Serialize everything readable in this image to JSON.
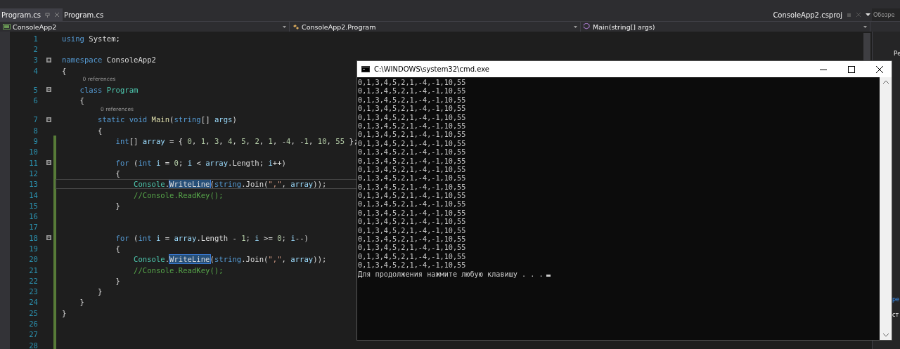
{
  "tabs": [
    {
      "label": "Program.cs",
      "selected": true,
      "pinned": true
    },
    {
      "label": "Program.cs",
      "selected": false,
      "pinned": false
    }
  ],
  "project_tab": {
    "label": "ConsoleApp2.csproj"
  },
  "navigation": {
    "project": "ConsoleApp2",
    "type": "ConsoleApp2.Program",
    "member": "Main(string[] args)"
  },
  "editor": {
    "lines": [
      {
        "number": "1",
        "fold": false,
        "modified": false,
        "segments": [
          {
            "kind": "kw",
            "text": "using"
          },
          {
            "kind": "plain",
            "text": " System;"
          }
        ]
      },
      {
        "number": "2",
        "fold": false,
        "modified": false
      },
      {
        "number": "3",
        "fold": true,
        "modified": false,
        "segments": [
          {
            "kind": "kw",
            "text": "namespace"
          },
          {
            "kind": "plain",
            "text": " ConsoleApp2"
          }
        ]
      },
      {
        "number": "4",
        "fold": false,
        "modified": false,
        "segments": [
          {
            "kind": "plain",
            "text": "{"
          }
        ]
      },
      {
        "number": "5",
        "fold": true,
        "modified": false,
        "lens": "0 references",
        "segments": [
          {
            "kind": "kw",
            "text": "    class "
          },
          {
            "kind": "type",
            "text": "Program"
          }
        ]
      },
      {
        "number": "6",
        "fold": false,
        "modified": false,
        "segments": [
          {
            "kind": "plain",
            "text": "    {"
          }
        ]
      },
      {
        "number": "7",
        "fold": true,
        "modified": false,
        "lens": "0 references",
        "segments": [
          {
            "kind": "kw",
            "text": "        static void "
          },
          {
            "kind": "method",
            "text": "Main"
          },
          {
            "kind": "plain",
            "text": "("
          },
          {
            "kind": "kw",
            "text": "string"
          },
          {
            "kind": "plain",
            "text": "[] "
          },
          {
            "kind": "param",
            "text": "args"
          },
          {
            "kind": "plain",
            "text": ")"
          }
        ]
      },
      {
        "number": "8",
        "fold": false,
        "modified": false,
        "segments": [
          {
            "kind": "plain",
            "text": "        {"
          }
        ]
      },
      {
        "number": "9",
        "fold": false,
        "modified": true,
        "segments": [
          {
            "kind": "kw",
            "text": "            int"
          },
          {
            "kind": "plain",
            "text": "[] "
          },
          {
            "kind": "param",
            "text": "array"
          },
          {
            "kind": "plain",
            "text": " = { "
          },
          {
            "kind": "num",
            "text": "0"
          },
          {
            "kind": "plain",
            "text": ", "
          },
          {
            "kind": "num",
            "text": "1"
          },
          {
            "kind": "plain",
            "text": ", "
          },
          {
            "kind": "num",
            "text": "3"
          },
          {
            "kind": "plain",
            "text": ", "
          },
          {
            "kind": "num",
            "text": "4"
          },
          {
            "kind": "plain",
            "text": ", "
          },
          {
            "kind": "num",
            "text": "5"
          },
          {
            "kind": "plain",
            "text": ", "
          },
          {
            "kind": "num",
            "text": "2"
          },
          {
            "kind": "plain",
            "text": ", "
          },
          {
            "kind": "num",
            "text": "1"
          },
          {
            "kind": "plain",
            "text": ", -"
          },
          {
            "kind": "num",
            "text": "4"
          },
          {
            "kind": "plain",
            "text": ", -"
          },
          {
            "kind": "num",
            "text": "1"
          },
          {
            "kind": "plain",
            "text": ", "
          },
          {
            "kind": "num",
            "text": "10"
          },
          {
            "kind": "plain",
            "text": ", "
          },
          {
            "kind": "num",
            "text": "55"
          },
          {
            "kind": "plain",
            "text": " };"
          }
        ]
      },
      {
        "number": "10",
        "fold": false,
        "modified": true
      },
      {
        "number": "11",
        "fold": true,
        "modified": true,
        "segments": [
          {
            "kind": "kw",
            "text": "            for"
          },
          {
            "kind": "plain",
            "text": " ("
          },
          {
            "kind": "kw",
            "text": "int "
          },
          {
            "kind": "param",
            "text": "i"
          },
          {
            "kind": "plain",
            "text": " = "
          },
          {
            "kind": "num",
            "text": "0"
          },
          {
            "kind": "plain",
            "text": "; "
          },
          {
            "kind": "param",
            "text": "i"
          },
          {
            "kind": "plain",
            "text": " < "
          },
          {
            "kind": "param",
            "text": "array"
          },
          {
            "kind": "plain",
            "text": ".Length; "
          },
          {
            "kind": "param",
            "text": "i"
          },
          {
            "kind": "plain",
            "text": "++)"
          }
        ]
      },
      {
        "number": "12",
        "fold": false,
        "modified": true,
        "segments": [
          {
            "kind": "plain",
            "text": "            {"
          }
        ]
      },
      {
        "number": "13",
        "fold": false,
        "modified": true,
        "current": true,
        "segments": [
          {
            "kind": "type",
            "text": "                Console"
          },
          {
            "kind": "plain",
            "text": "."
          },
          {
            "kind": "highlight",
            "text": "WriteLine"
          },
          {
            "kind": "plain",
            "text": "("
          },
          {
            "kind": "kw",
            "text": "string"
          },
          {
            "kind": "plain",
            "text": ".Join("
          },
          {
            "kind": "str",
            "text": "\",\""
          },
          {
            "kind": "plain",
            "text": ", "
          },
          {
            "kind": "param",
            "text": "array"
          },
          {
            "kind": "plain",
            "text": "));"
          }
        ]
      },
      {
        "number": "14",
        "fold": false,
        "modified": true,
        "segments": [
          {
            "kind": "comment",
            "text": "                //Console.ReadKey();"
          }
        ]
      },
      {
        "number": "15",
        "fold": false,
        "modified": true,
        "segments": [
          {
            "kind": "plain",
            "text": "            }"
          }
        ]
      },
      {
        "number": "16",
        "fold": false,
        "modified": true
      },
      {
        "number": "17",
        "fold": false,
        "modified": true
      },
      {
        "number": "18",
        "fold": true,
        "modified": true,
        "segments": [
          {
            "kind": "kw",
            "text": "            for"
          },
          {
            "kind": "plain",
            "text": " ("
          },
          {
            "kind": "kw",
            "text": "int "
          },
          {
            "kind": "param",
            "text": "i"
          },
          {
            "kind": "plain",
            "text": " = "
          },
          {
            "kind": "param",
            "text": "array"
          },
          {
            "kind": "plain",
            "text": ".Length - "
          },
          {
            "kind": "num",
            "text": "1"
          },
          {
            "kind": "plain",
            "text": "; "
          },
          {
            "kind": "param",
            "text": "i"
          },
          {
            "kind": "plain",
            "text": " >= "
          },
          {
            "kind": "num",
            "text": "0"
          },
          {
            "kind": "plain",
            "text": "; "
          },
          {
            "kind": "param",
            "text": "i"
          },
          {
            "kind": "plain",
            "text": "--)"
          }
        ]
      },
      {
        "number": "19",
        "fold": false,
        "modified": true,
        "segments": [
          {
            "kind": "plain",
            "text": "            {"
          }
        ]
      },
      {
        "number": "20",
        "fold": false,
        "modified": true,
        "segments": [
          {
            "kind": "type",
            "text": "                Console"
          },
          {
            "kind": "plain",
            "text": "."
          },
          {
            "kind": "highlight",
            "text": "WriteLine"
          },
          {
            "kind": "plain",
            "text": "("
          },
          {
            "kind": "kw",
            "text": "string"
          },
          {
            "kind": "plain",
            "text": ".Join("
          },
          {
            "kind": "str",
            "text": "\",\""
          },
          {
            "kind": "plain",
            "text": ", "
          },
          {
            "kind": "param",
            "text": "array"
          },
          {
            "kind": "plain",
            "text": "));"
          }
        ]
      },
      {
        "number": "21",
        "fold": false,
        "modified": true,
        "segments": [
          {
            "kind": "comment",
            "text": "                //Console.ReadKey();"
          }
        ]
      },
      {
        "number": "22",
        "fold": false,
        "modified": true,
        "segments": [
          {
            "kind": "plain",
            "text": "            }"
          }
        ]
      },
      {
        "number": "23",
        "fold": false,
        "modified": true,
        "segments": [
          {
            "kind": "plain",
            "text": "        }"
          }
        ]
      },
      {
        "number": "24",
        "fold": false,
        "modified": true,
        "segments": [
          {
            "kind": "plain",
            "text": "    }"
          }
        ]
      },
      {
        "number": "25",
        "fold": false,
        "modified": true,
        "segments": [
          {
            "kind": "plain",
            "text": "}"
          }
        ]
      },
      {
        "number": "26",
        "fold": false,
        "modified": true
      },
      {
        "number": "27",
        "fold": false,
        "modified": true
      },
      {
        "number": "28",
        "fold": false,
        "modified": true
      }
    ]
  },
  "console": {
    "title": "C:\\WINDOWS\\system32\\cmd.exe",
    "lines": [
      "0,1,3,4,5,2,1,-4,-1,10,55",
      "0,1,3,4,5,2,1,-4,-1,10,55",
      "0,1,3,4,5,2,1,-4,-1,10,55",
      "0,1,3,4,5,2,1,-4,-1,10,55",
      "0,1,3,4,5,2,1,-4,-1,10,55",
      "0,1,3,4,5,2,1,-4,-1,10,55",
      "0,1,3,4,5,2,1,-4,-1,10,55",
      "0,1,3,4,5,2,1,-4,-1,10,55",
      "0,1,3,4,5,2,1,-4,-1,10,55",
      "0,1,3,4,5,2,1,-4,-1,10,55",
      "0,1,3,4,5,2,1,-4,-1,10,55",
      "0,1,3,4,5,2,1,-4,-1,10,55",
      "0,1,3,4,5,2,1,-4,-1,10,55",
      "0,1,3,4,5,2,1,-4,-1,10,55",
      "0,1,3,4,5,2,1,-4,-1,10,55",
      "0,1,3,4,5,2,1,-4,-1,10,55",
      "0,1,3,4,5,2,1,-4,-1,10,55",
      "0,1,3,4,5,2,1,-4,-1,10,55",
      "0,1,3,4,5,2,1,-4,-1,10,55",
      "0,1,3,4,5,2,1,-4,-1,10,55",
      "0,1,3,4,5,2,1,-4,-1,10,55",
      "0,1,3,4,5,2,1,-4,-1,10,55"
    ],
    "prompt": "Для продолжения нажмите любую клавишу . . ."
  },
  "side_panel": {
    "title": "Обозре",
    "items": [
      "Ре"
    ],
    "bottom_items": [
      "ре",
      "ст"
    ]
  }
}
